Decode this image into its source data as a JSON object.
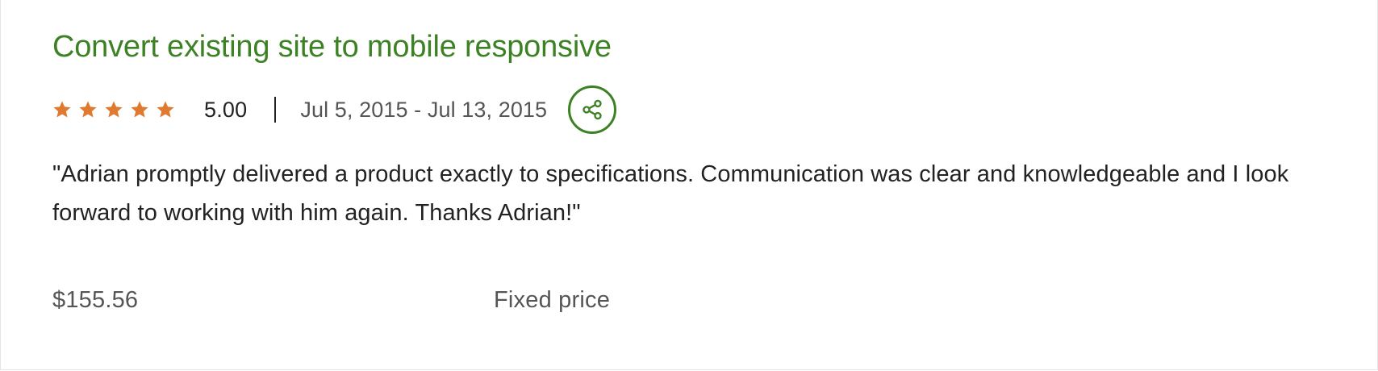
{
  "job": {
    "title": "Convert existing site to mobile responsive",
    "rating": {
      "stars": 5,
      "max_stars": 5,
      "value_label": "5.00"
    },
    "date_range": "Jul 5, 2015 - Jul 13, 2015",
    "share_icon": "share-icon",
    "review": "\"Adrian promptly delivered a product exactly to specifications. Communication was clear and knowledgeable and I look forward to working with him again. Thanks Adrian!\"",
    "price": "$155.56",
    "price_type": "Fixed price"
  },
  "colors": {
    "title_green": "#3c8224",
    "star_orange": "#e07a30",
    "text_dark": "#222222",
    "text_muted": "#555555"
  }
}
